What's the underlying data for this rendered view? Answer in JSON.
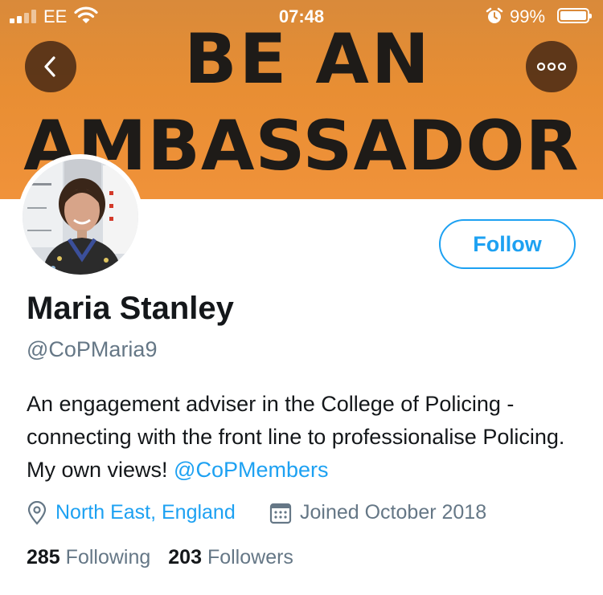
{
  "status_bar": {
    "carrier": "EE",
    "time": "07:48",
    "battery_percent": "99%"
  },
  "banner": {
    "line1": "BE AN",
    "line2": "AMBASSADOR"
  },
  "nav": {
    "back_icon": "chevron-left-icon",
    "more_icon": "more-horizontal-icon"
  },
  "profile": {
    "follow_label": "Follow",
    "name": "Maria Stanley",
    "handle": "@CoPMaria9",
    "bio_text": "An engagement adviser in the College of Policing - connecting with the front line to professionalise Policing. My own views! ",
    "bio_mention": "@CoPMembers",
    "location": "North East, England",
    "joined": "Joined October 2018",
    "following_count": "285",
    "following_label": "Following",
    "followers_count": "203",
    "followers_label": "Followers"
  },
  "colors": {
    "accent": "#1da1f2",
    "secondary_text": "#657786",
    "banner_orange": "#e88e33"
  }
}
